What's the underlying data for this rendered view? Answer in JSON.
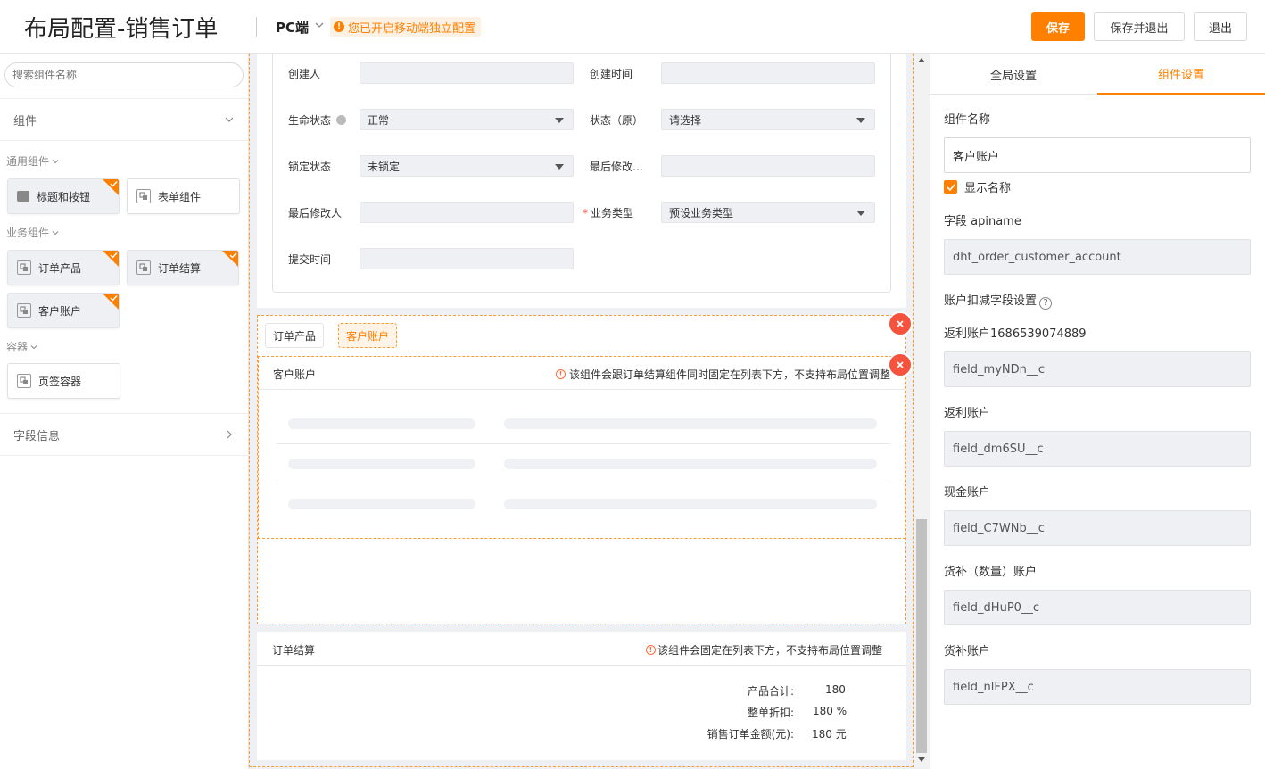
{
  "header": {
    "title": "布局配置-销售订单",
    "platform": "PC端",
    "notice": "您已开启移动端独立配置",
    "save": "保存",
    "save_exit": "保存并退出",
    "exit": "退出"
  },
  "left": {
    "search_placeholder": "搜索组件名称",
    "components_title": "组件",
    "groups": {
      "general": "通用组件",
      "business": "业务组件",
      "container": "容器"
    },
    "items": {
      "title_button": "标题和按钮",
      "form": "表单组件",
      "order_product": "订单产品",
      "order_settle": "订单结算",
      "customer_account": "客户账户",
      "tab_container": "页签容器"
    },
    "field_info": "字段信息"
  },
  "form": {
    "creator": "创建人",
    "create_time": "创建时间",
    "life_status": "生命状态",
    "life_status_value": "正常",
    "status_orig": "状态（原）",
    "status_orig_value": "请选择",
    "lock_status": "锁定状态",
    "lock_status_value": "未锁定",
    "last_modified": "最后修改…",
    "last_modifier": "最后修改人",
    "biz_type": "业务类型",
    "biz_type_value": "预设业务类型",
    "submit_time": "提交时间"
  },
  "tabs": {
    "tab1": "订单产品",
    "tab2": "客户账户",
    "component_name": "客户账户",
    "warning": "该组件会跟订单结算组件同时固定在列表下方，不支持布局位置调整"
  },
  "summary": {
    "name": "订单结算",
    "warning": "该组件会固定在列表下方，不支持布局位置调整",
    "rows": [
      {
        "label": "产品合计:",
        "value": "180"
      },
      {
        "label": "整单折扣:",
        "value": "180 %"
      },
      {
        "label": "销售订单金额(元):",
        "value": "180 元"
      }
    ]
  },
  "right": {
    "tab_global": "全局设置",
    "tab_component": "组件设置",
    "name_label": "组件名称",
    "name_value": "客户账户",
    "show_name": "显示名称",
    "apiname_label": "字段 apiname",
    "apiname_value": "dht_order_customer_account",
    "deduct_label": "账户扣减字段设置",
    "fields": [
      {
        "label": "返利账户1686539074889",
        "value": "field_myNDn__c"
      },
      {
        "label": "返利账户",
        "value": "field_dm6SU__c"
      },
      {
        "label": "现金账户",
        "value": "field_C7WNb__c"
      },
      {
        "label": "货补（数量）账户",
        "value": "field_dHuP0__c"
      },
      {
        "label": "货补账户",
        "value": "field_nlFPX__c"
      }
    ]
  },
  "colors": {
    "accent": "#ff8000",
    "danger": "#f5533d"
  }
}
